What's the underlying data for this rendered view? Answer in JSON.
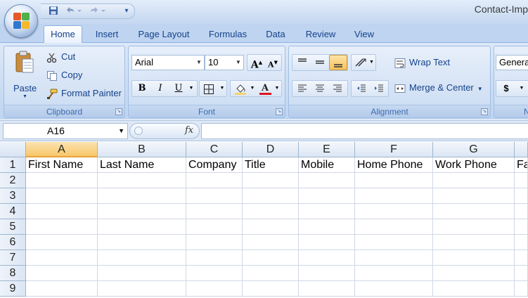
{
  "title": "Contact-Imp",
  "quick_access": {
    "save_icon": "save-icon",
    "undo_icon": "undo-icon",
    "redo_icon": "redo-icon",
    "more": "▾"
  },
  "tabs": [
    "Home",
    "Insert",
    "Page Layout",
    "Formulas",
    "Data",
    "Review",
    "View"
  ],
  "clipboard": {
    "paste": "Paste",
    "cut": "Cut",
    "copy": "Copy",
    "format_painter": "Format Painter",
    "label": "Clipboard"
  },
  "font": {
    "name": "Arial",
    "size": "10",
    "grow": "A",
    "shrink": "A",
    "bold": "B",
    "italic": "I",
    "underline": "U",
    "color_letter": "A",
    "label": "Font"
  },
  "alignment": {
    "wrap_text": "Wrap Text",
    "merge_center": "Merge & Center",
    "label": "Alignment"
  },
  "number": {
    "format": "Genera",
    "currency": "$",
    "label": "N"
  },
  "formula_bar": {
    "name_box": "A16",
    "fx": "fx",
    "value": ""
  },
  "sheet": {
    "columns": [
      "A",
      "B",
      "C",
      "D",
      "E",
      "F",
      "G"
    ],
    "rows": [
      "1",
      "2",
      "3",
      "4",
      "5",
      "6",
      "7",
      "8",
      "9"
    ],
    "row1": [
      "First Name",
      "Last Name",
      "Company",
      "Title",
      "Mobile",
      "Home Phone",
      "Work Phone",
      "Fa"
    ],
    "selected_column": "A"
  },
  "colors": {
    "accent": "#15428b",
    "ribbon": "#dce8f7",
    "selected_header": "#f8c76a",
    "grid_line": "#d0d7e5"
  }
}
